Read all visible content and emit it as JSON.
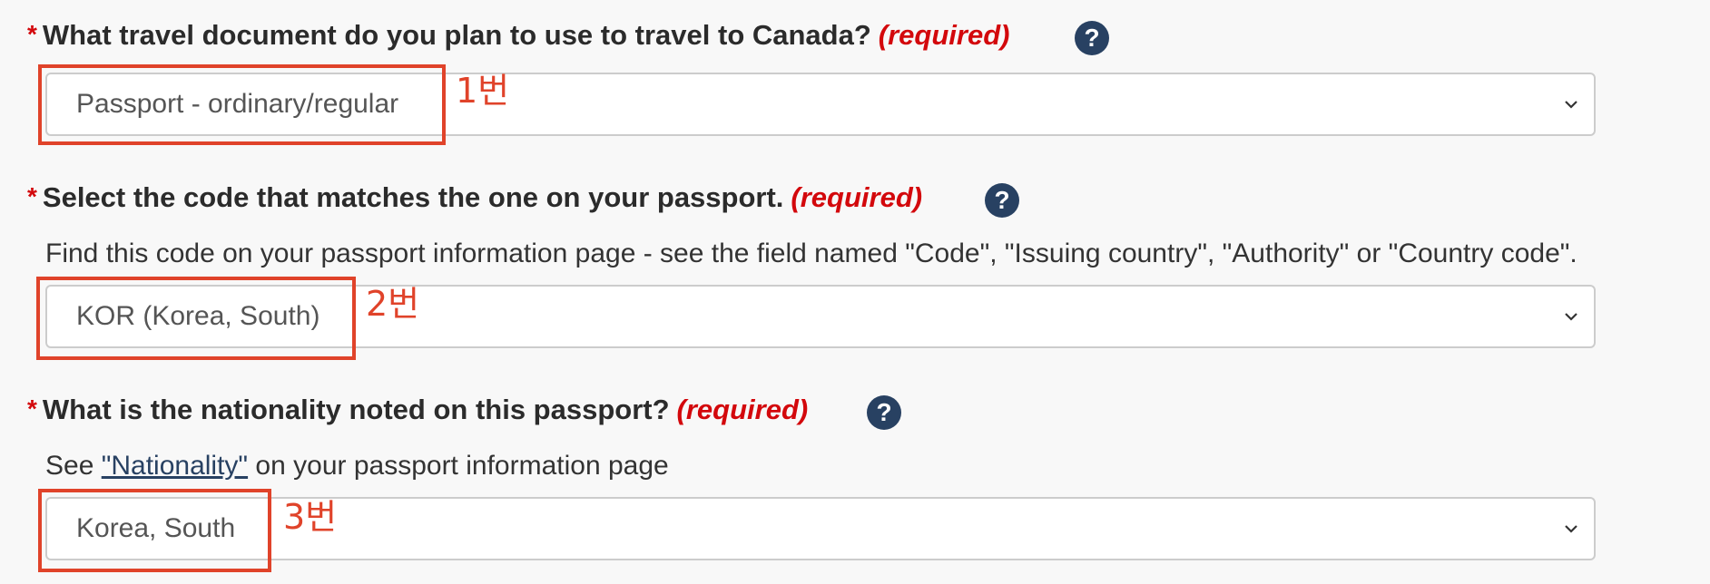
{
  "questions": [
    {
      "label": "What travel document do you plan to use to travel to Canada?",
      "asterisk": "*",
      "required": "(required)",
      "help_icon": "?",
      "selected": "Passport - ordinary/regular",
      "annotation": "1번"
    },
    {
      "label": "Select the code that matches the one on your passport.",
      "asterisk": "*",
      "required": "(required)",
      "help_icon": "?",
      "hint": "Find this code on your passport information page - see the field named \"Code\", \"Issuing country\", \"Authority\" or \"Country code\".",
      "selected": "KOR (Korea, South)",
      "annotation": "2번"
    },
    {
      "label": "What is the nationality noted on this passport?",
      "asterisk": "*",
      "required": "(required)",
      "help_icon": "?",
      "hint_prefix": "See ",
      "hint_link": "\"Nationality\"",
      "hint_suffix": " on your passport information page",
      "selected": "Korea, South",
      "annotation": "3번"
    }
  ],
  "colors": {
    "required_red": "#d3080c",
    "help_icon_bg": "#284162",
    "annotation_red": "#e0432a",
    "page_bg": "#f8f8f8"
  },
  "icons": {
    "help": "question-circle-icon",
    "dropdown": "chevron-down-icon"
  }
}
